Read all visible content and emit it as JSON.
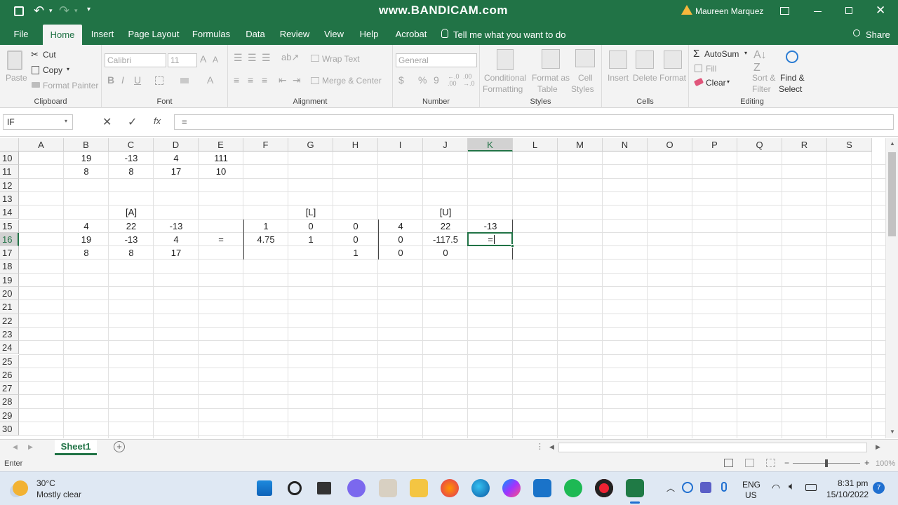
{
  "titlebar": {
    "watermark": "www.BANDICAM.com",
    "user": "Maureen Marquez",
    "qat_more": "▾"
  },
  "tabs": [
    "File",
    "Home",
    "Insert",
    "Page Layout",
    "Formulas",
    "Data",
    "Review",
    "View",
    "Help",
    "Acrobat"
  ],
  "tell_me": "Tell me what you want to do",
  "share": "Share",
  "ribbon": {
    "clipboard": {
      "paste": "Paste",
      "cut": "Cut",
      "copy": "Copy",
      "format_painter": "Format Painter",
      "label": "Clipboard"
    },
    "font": {
      "name": "Calibri",
      "size": "11",
      "label": "Font"
    },
    "alignment": {
      "wrap": "Wrap Text",
      "merge": "Merge & Center",
      "label": "Alignment"
    },
    "number": {
      "format": "General",
      "label": "Number"
    },
    "styles": {
      "cond1": "Conditional",
      "cond2": "Formatting",
      "fmt1": "Format as",
      "fmt2": "Table",
      "cell1": "Cell",
      "cell2": "Styles",
      "label": "Styles"
    },
    "cells": {
      "insert": "Insert",
      "delete": "Delete",
      "format": "Format",
      "label": "Cells"
    },
    "editing": {
      "autosum": "AutoSum",
      "fill": "Fill",
      "clear": "Clear",
      "sort1": "Sort &",
      "sort2": "Filter",
      "find1": "Find &",
      "find2": "Select",
      "label": "Editing"
    }
  },
  "formula_bar": {
    "name_box": "IF",
    "fx": "fx",
    "formula": "="
  },
  "columns": [
    "A",
    "B",
    "C",
    "D",
    "E",
    "F",
    "G",
    "H",
    "I",
    "J",
    "K",
    "L",
    "M",
    "N",
    "O",
    "P",
    "Q",
    "R",
    "S"
  ],
  "rows": [
    "10",
    "11",
    "12",
    "13",
    "14",
    "15",
    "16",
    "17",
    "18",
    "19",
    "20",
    "21",
    "22",
    "23",
    "24",
    "25",
    "26",
    "27",
    "28",
    "29",
    "30"
  ],
  "selected": {
    "column": "K",
    "row": "16"
  },
  "cells": {
    "B10": "19",
    "C10": "-13",
    "D10": "4",
    "E10": "111",
    "B11": "8",
    "C11": "8",
    "D11": "17",
    "E11": "10",
    "C14": "[A]",
    "G14": "[L]",
    "J14": "[U]",
    "B15": "4",
    "C15": "22",
    "D15": "-13",
    "F15": "1",
    "G15": "0",
    "H15": "0",
    "I15": "4",
    "J15": "22",
    "K15": "-13",
    "B16": "19",
    "C16": "-13",
    "D16": "4",
    "E16": "=",
    "F16": "4.75",
    "G16": "1",
    "H16": "0",
    "I16": "0",
    "J16": "-117.5",
    "K16": "=",
    "B17": "8",
    "C17": "8",
    "D17": "17",
    "H17": "1",
    "I17": "0",
    "J17": "0"
  },
  "sheet_tab": "Sheet1",
  "status": {
    "mode": "Enter",
    "zoom": "100%"
  },
  "taskbar": {
    "temp": "30°C",
    "weather": "Mostly clear",
    "lang1": "ENG",
    "lang2": "US",
    "time": "8:31 pm",
    "date": "15/10/2022",
    "notifications": "7"
  }
}
